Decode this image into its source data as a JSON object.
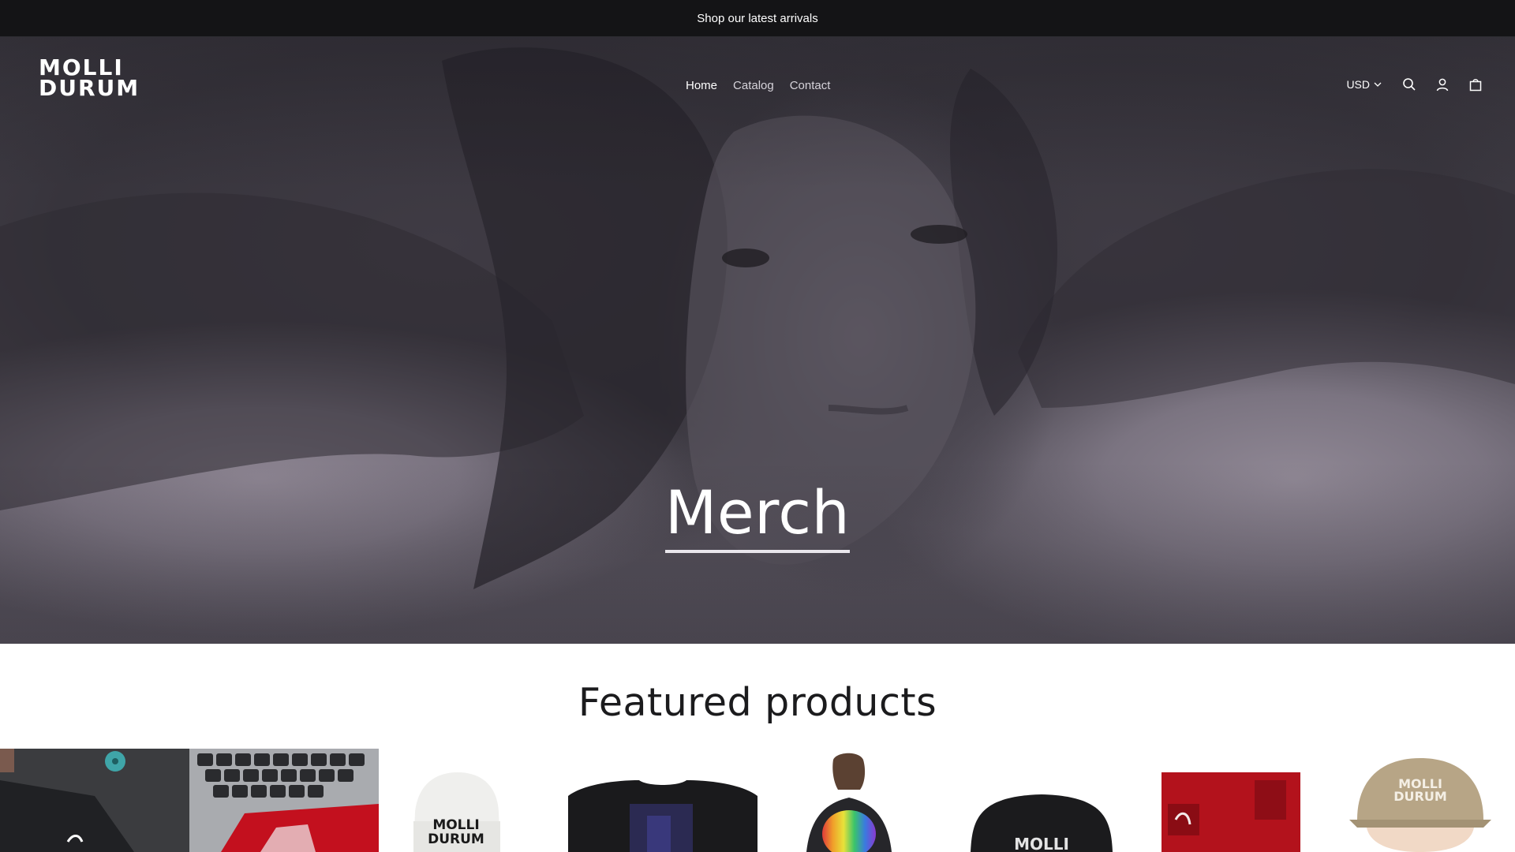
{
  "announcement": {
    "text": "Shop our latest arrivals"
  },
  "header": {
    "logo_line1": "MOLLI",
    "logo_line2": "DURUM",
    "nav": [
      {
        "label": "Home",
        "active": true
      },
      {
        "label": "Catalog",
        "active": false
      },
      {
        "label": "Contact",
        "active": false
      }
    ],
    "currency": "USD",
    "icons": [
      "search-icon",
      "account-icon",
      "cart-icon"
    ]
  },
  "hero": {
    "title": "Merch"
  },
  "featured": {
    "heading": "Featured products",
    "products": [
      {
        "name": "product-sticker-dark",
        "logo_text": ""
      },
      {
        "name": "product-laptop-sticker",
        "logo_text": ""
      },
      {
        "name": "product-white-beanie",
        "logo_text": "MOLLI DURUM"
      },
      {
        "name": "product-black-jacket",
        "logo_text": ""
      },
      {
        "name": "product-rainbow-top",
        "logo_text": ""
      },
      {
        "name": "product-black-bucket-hat",
        "logo_text": "MOLLI"
      },
      {
        "name": "product-red-print",
        "logo_text": ""
      },
      {
        "name": "product-tan-cap",
        "logo_text": "MOLLI DURUM"
      }
    ]
  },
  "colors": {
    "announcement_bg": "#141416",
    "hero_tone": "#4a4650",
    "text_dark": "#1b1b1d"
  }
}
